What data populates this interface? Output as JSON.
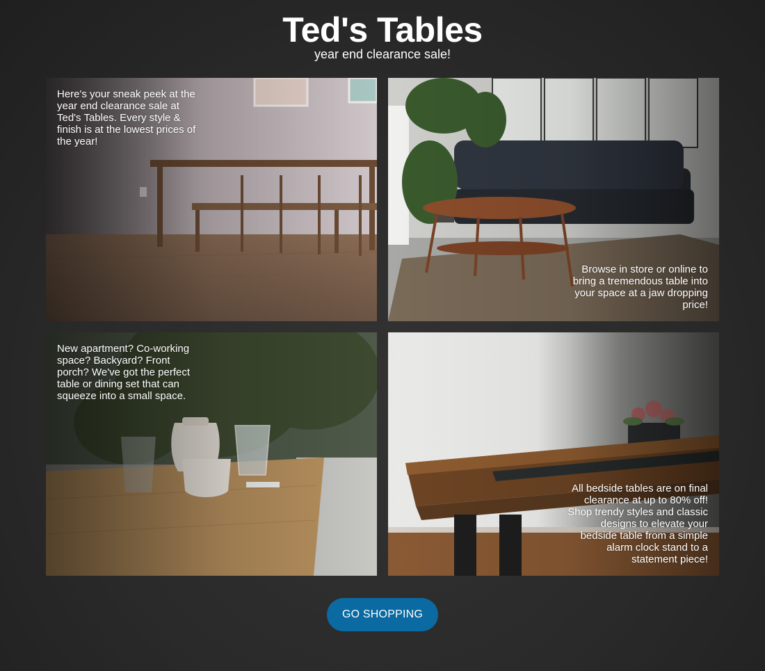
{
  "header": {
    "title": "Ted's Tables",
    "subtitle": "year end clearance sale!"
  },
  "tiles": [
    {
      "caption": "Here's your sneak peek at the year end clearance sale at Ted's Tables. Every style & finish is at the lowest prices of the year!",
      "image": "dining-table-with-bench-photo"
    },
    {
      "caption": "Browse in store or online to bring a tremendous table into your space at a jaw dropping price!",
      "image": "coffee-table-and-sofa-photo"
    },
    {
      "caption": "New apartment? Co-working space? Backyard? Front porch? We've got the perfect table or dining set that can squeeze into a small space.",
      "image": "small-wood-table-with-cups-photo"
    },
    {
      "caption": "All bedside tables are on final clearance at up to 80% off! Shop trendy styles and classic designs to elevate your bedside table from a simple alarm clock stand to a statement piece!",
      "image": "resin-wood-bedside-table-photo"
    }
  ],
  "cta": {
    "label": "GO SHOPPING",
    "color": "#0a6aa1"
  }
}
